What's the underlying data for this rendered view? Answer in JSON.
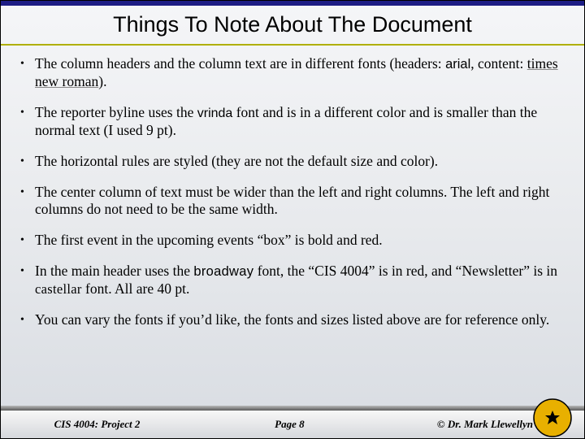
{
  "title": "Things To Note About The Document",
  "bullets": [
    {
      "prefix": "The column headers and the column text are in different fonts (headers: ",
      "font1": "arial",
      "mid1": ", content: ",
      "font2": "times new roman",
      "suffix": ")."
    },
    {
      "prefix": "The reporter byline uses the ",
      "font1": "vrinda",
      "suffix": " font and is in a different color and is smaller than the normal text (I used 9 pt)."
    },
    {
      "text": "The horizontal rules are styled (they are not the default size and color)."
    },
    {
      "text": "The center column of text must be wider than the left and right columns. The left and right columns do not need to be the same width."
    },
    {
      "text": "The first event in the upcoming events “box” is bold and red."
    },
    {
      "prefix": "In the main header uses the ",
      "font1": "broadway",
      "mid1": " font, the “CIS 4004” is in red, and “Newsletter” is in ",
      "font2": "castellar",
      "suffix": " font.  All are 40 pt."
    },
    {
      "text": "You can vary the fonts if you’d like, the fonts and sizes listed above are for reference only."
    }
  ],
  "footer": {
    "left": "CIS 4004:  Project 2",
    "center": "Page 8",
    "right": "© Dr. Mark Llewellyn"
  }
}
